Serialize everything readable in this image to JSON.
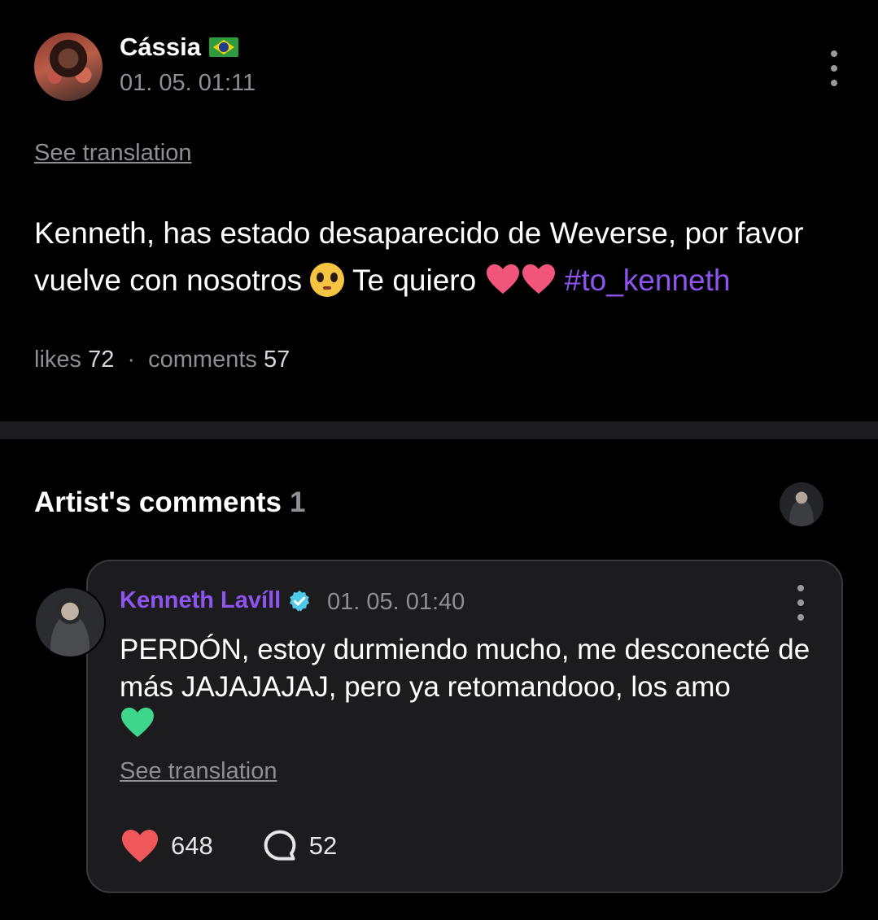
{
  "post": {
    "author": "Cássia",
    "author_flag_icon": "brazil-flag-icon",
    "timestamp": "01. 05. 01:11",
    "see_translation": "See translation",
    "body_text_1": "Kenneth, has estado desaparecido de Weverse, por favor vuelve con nosotros",
    "body_text_2": "Te quiero",
    "hashtag": "#to_kenneth",
    "likes_label": "likes",
    "likes_count": "72",
    "separator": "·",
    "comments_label": "comments",
    "comments_count": "57"
  },
  "artist_comments": {
    "title": "Artist's comments",
    "count": "1"
  },
  "comment": {
    "author": "Kenneth Lavíll",
    "verified_icon": "verified-badge-icon",
    "timestamp": "01. 05. 01:40",
    "body": "PERDÓN, estoy durmiendo mucho, me desconecté de más JAJAJAJAJ, pero ya retomandooo, los amo",
    "see_translation": "See translation",
    "like_count": "648",
    "reply_count": "52"
  },
  "colors": {
    "background": "#000000",
    "card": "#1c1c1e",
    "accent_purple": "#8e54f0",
    "muted": "#8e8e93",
    "heart_red": "#f0575a",
    "heart_pink": "#f2557a",
    "heart_green": "#3ed68a"
  }
}
